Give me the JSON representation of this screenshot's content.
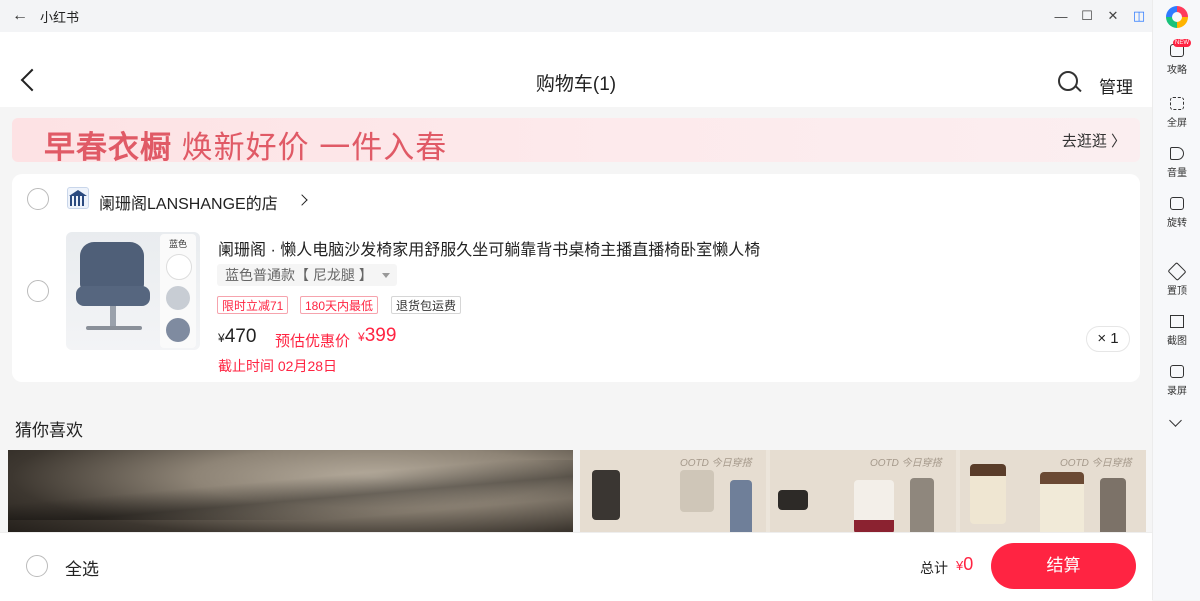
{
  "window": {
    "title": "小红书",
    "back_glyph": "←",
    "controls": [
      "—",
      "☐",
      "✕",
      "◫"
    ]
  },
  "sidebar": {
    "items": [
      {
        "label": "攻略",
        "icon": "guide-icon",
        "badge": "NEW"
      },
      {
        "label": "全屏",
        "icon": "fullscreen-icon"
      },
      {
        "label": "音量",
        "icon": "volume-icon"
      },
      {
        "label": "旋转",
        "icon": "rotate-icon"
      },
      {
        "label": "置顶",
        "icon": "pin-icon"
      },
      {
        "label": "截图",
        "icon": "crop-icon"
      },
      {
        "label": "录屏",
        "icon": "record-icon"
      }
    ]
  },
  "header": {
    "title": "购物车(1)",
    "manage_label": "管理"
  },
  "banner": {
    "text_bold": "早春衣橱",
    "text_rest": " 焕新好价 一件入春",
    "link_label": "去逛逛 〉"
  },
  "shop": {
    "name": "阑珊阁LANSHANGE的店"
  },
  "product": {
    "title": "阑珊阁 · 懒人电脑沙发椅家用舒服久坐可躺靠背书桌椅主播直播椅卧室懒人椅",
    "variant": "蓝色普通款【 尼龙腿 】",
    "image_swatch_label": "蓝色",
    "tags": [
      "限时立减71",
      "180天内最低",
      "退货包运费"
    ],
    "currency": "¥",
    "price": "470",
    "estimate_label": "预估优惠价",
    "estimate_price": "399",
    "deadline": "截止时间 02月28日",
    "quantity": "× 1"
  },
  "recommend": {
    "title": "猜你喜欢",
    "ootd_label": "OOTD 今日穿搭"
  },
  "bottom": {
    "select_all": "全选",
    "total_label": "总计",
    "currency": "¥",
    "total_value": "0",
    "checkout_label": "结算"
  },
  "colors": {
    "accent": "#ff2442",
    "banner_text": "#e05a66"
  }
}
